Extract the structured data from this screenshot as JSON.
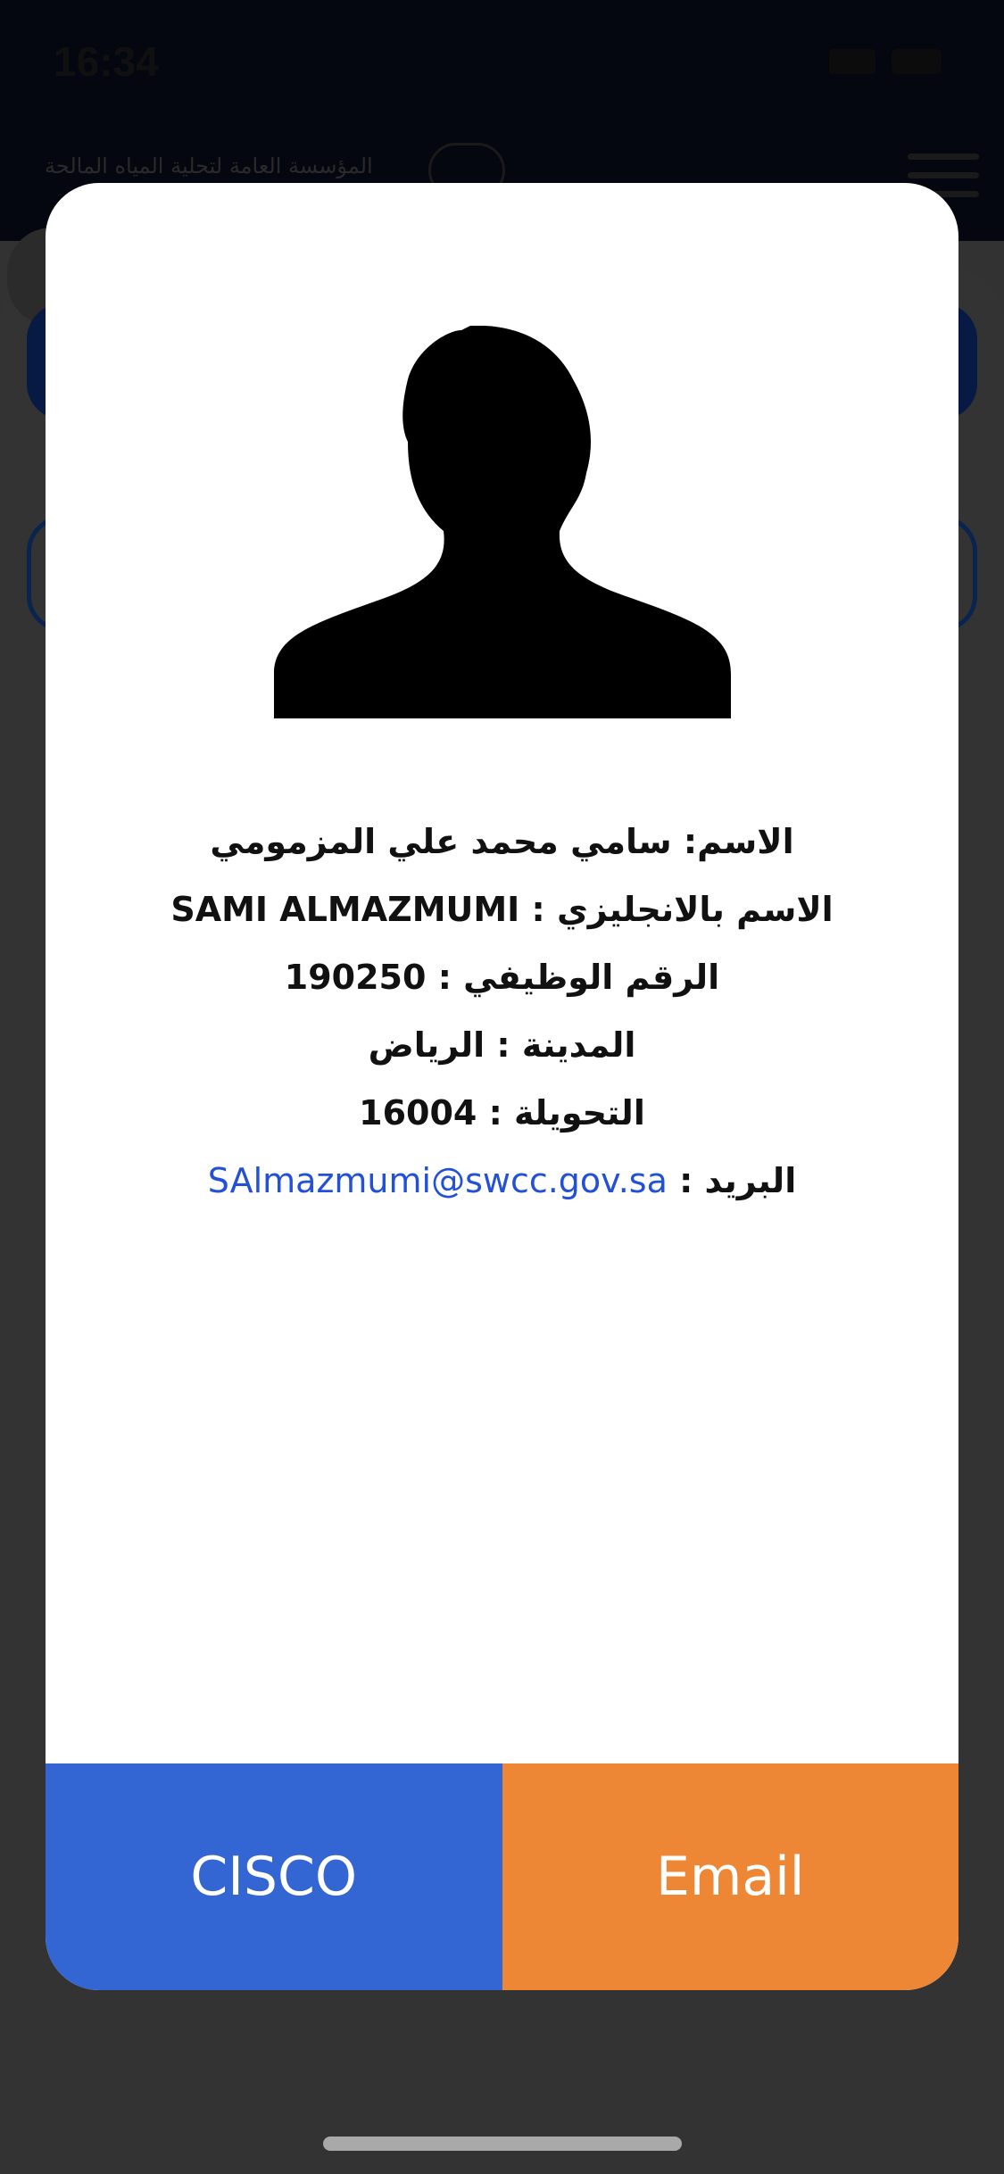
{
  "status_bar": {
    "time": "16:34"
  },
  "header": {
    "title": "المؤسسة العامة لتحلية المياه المالحة"
  },
  "profile": {
    "name_label": "الاسم:",
    "name_value": "سامي محمد علي المزمومي",
    "english_name_label": "الاسم بالانجليزي :",
    "english_name_value": "SAMI ALMAZMUMI",
    "employee_id_label": "الرقم الوظيفي :",
    "employee_id_value": "190250",
    "city_label": "المدينة :",
    "city_value": "الرياض",
    "extension_label": "التحويلة :",
    "extension_value": "16004",
    "email_label": "البريد :",
    "email_value": "SAlmazmumi@swcc.gov.sa"
  },
  "actions": {
    "cisco_label": "CISCO",
    "email_label": "Email"
  },
  "colors": {
    "cisco_button": "#3366d3",
    "email_button": "#ee8735",
    "email_link": "#2350d8",
    "overlay": "#323232"
  },
  "icons": {
    "avatar": "person-silhouette-icon",
    "menu": "hamburger-menu-icon"
  }
}
